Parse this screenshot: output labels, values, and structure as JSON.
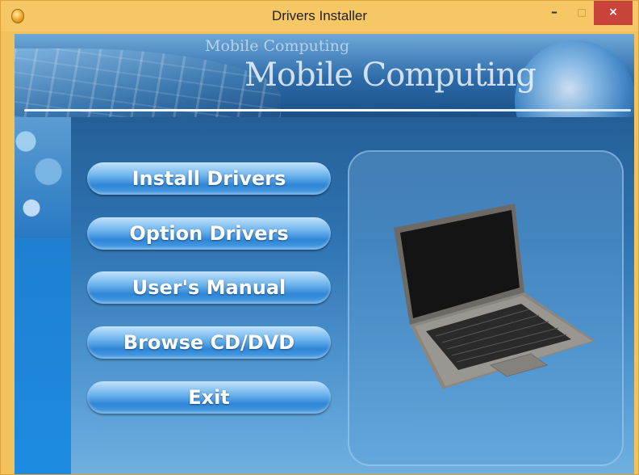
{
  "window": {
    "title": "Drivers Installer",
    "controls": {
      "minimize": "–",
      "maximize": "□",
      "close": "×"
    }
  },
  "banner": {
    "subtitle": "Mobile Computing",
    "title": "Mobile Computing"
  },
  "menu": {
    "buttons": [
      {
        "label": "Install Drivers"
      },
      {
        "label": "Option Drivers"
      },
      {
        "label": "User's Manual"
      },
      {
        "label": "Browse CD/DVD"
      },
      {
        "label": "Exit"
      }
    ]
  },
  "colors": {
    "titlebar": "#f5c765",
    "close_button": "#c9433a",
    "button_text": "#ffffff"
  },
  "icons": {
    "app": "app-icon",
    "laptop": "laptop-image"
  }
}
